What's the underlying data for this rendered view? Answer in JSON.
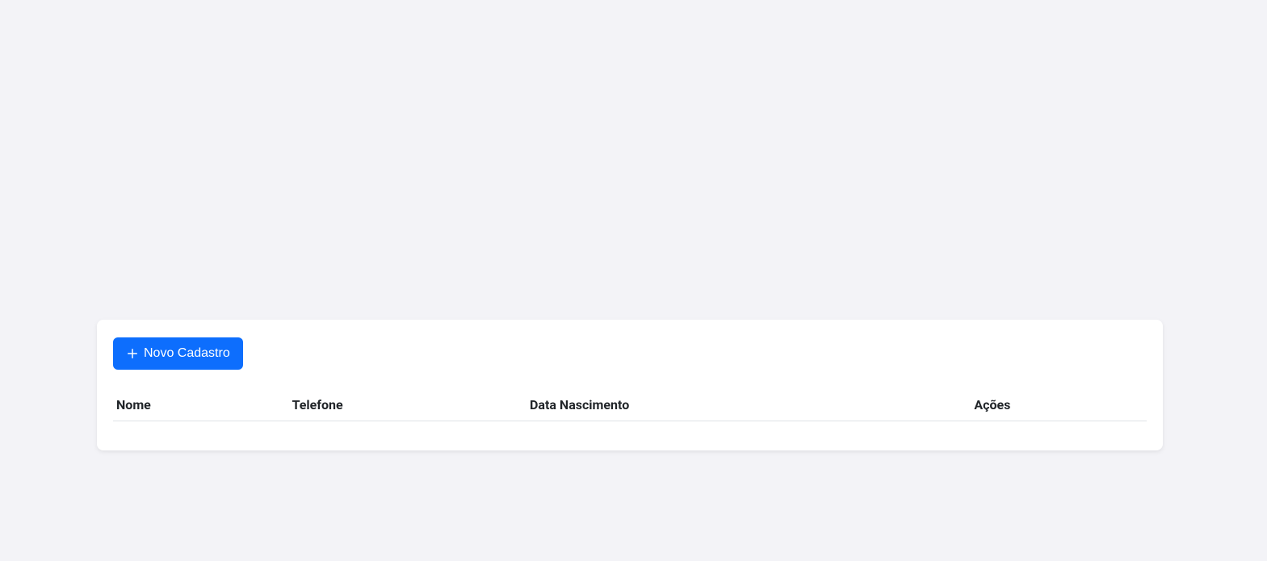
{
  "button": {
    "new_label": "Novo Cadastro"
  },
  "table": {
    "headers": {
      "nome": "Nome",
      "telefone": "Telefone",
      "data": "Data Nascimento",
      "acoes": "Ações"
    },
    "rows": []
  }
}
